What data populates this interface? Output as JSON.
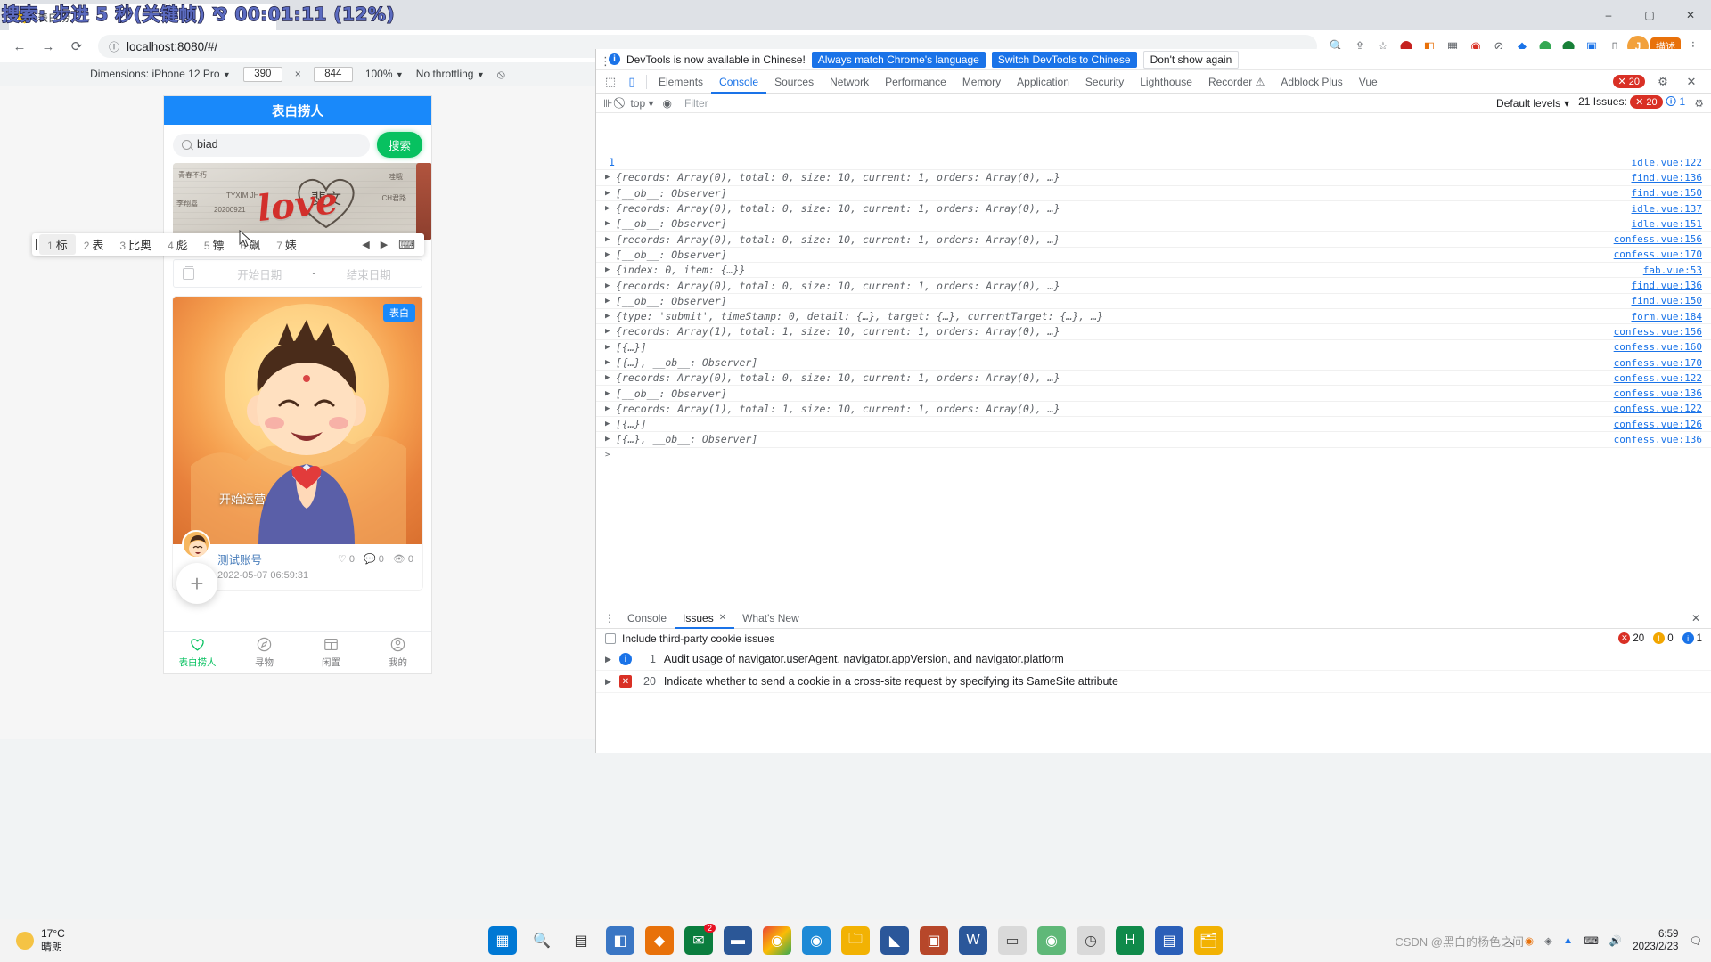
{
  "recorder_overlay": "搜索: 步进 5 秒(关键帧) ⅋ 00:01:11 (12%)",
  "browser": {
    "tab_title": "表白捞人",
    "url": "localhost:8080/#/",
    "window_buttons": [
      "–",
      "▢",
      "✕"
    ],
    "nav": {
      "back": "←",
      "forward": "→",
      "reload": "⟳"
    },
    "profile_initial": "J",
    "extension_badge": "描述",
    "toolbar_icons": [
      "zoom-icon",
      "share-icon",
      "bookmark-star-icon",
      "ext-1",
      "ext-2",
      "ext-3",
      "ext-4",
      "ext-5",
      "ext-6",
      "ext-7",
      "ext-8",
      "ext-9",
      "ext-10",
      "sidepanel-icon"
    ],
    "menu_icon": "⋮"
  },
  "device_toolbar": {
    "dimensions_label": "Dimensions: iPhone 12 Pro",
    "width": "390",
    "x": "×",
    "height": "844",
    "zoom": "100%",
    "throttling": "No throttling",
    "rotate_icon": "rotate-icon"
  },
  "app": {
    "title": "表白捞人",
    "search": {
      "value": "biad",
      "placeholder": "",
      "button": "搜索",
      "icon": "search-icon"
    },
    "ime": {
      "candidates": [
        {
          "num": "1",
          "text": "标"
        },
        {
          "num": "2",
          "text": "表"
        },
        {
          "num": "3",
          "text": "比奥"
        },
        {
          "num": "4",
          "text": "彪"
        },
        {
          "num": "5",
          "text": "镖"
        },
        {
          "num": "6",
          "text": "飙"
        },
        {
          "num": "7",
          "text": "婊"
        }
      ],
      "prev": "◀",
      "next": "▶",
      "panel": "keyboard-icon"
    },
    "carousel": {
      "dots": 2,
      "active": 0,
      "banner_text": "love"
    },
    "date_filter": {
      "start": "开始日期",
      "dash": "-",
      "end": "结束日期",
      "icon": "calendar-icon"
    },
    "post": {
      "tag": "表白",
      "caption": "开始运营",
      "author": "测试账号",
      "time": "2022-05-07 06:59:31",
      "stats": [
        "0",
        "0",
        "0"
      ]
    },
    "fab": "+",
    "tabbar": [
      {
        "label": "表白捞人",
        "icon": "heart-icon",
        "active": true
      },
      {
        "label": "寻物",
        "icon": "compass-icon",
        "active": false
      },
      {
        "label": "闲置",
        "icon": "box-icon",
        "active": false
      },
      {
        "label": "我的",
        "icon": "user-icon",
        "active": false
      }
    ]
  },
  "devtools": {
    "banner": {
      "message": "DevTools is now available in Chinese!",
      "btn_match": "Always match Chrome's language",
      "btn_switch": "Switch DevTools to Chinese",
      "btn_dismiss": "Don't show again"
    },
    "tabs": [
      "Elements",
      "Console",
      "Sources",
      "Network",
      "Performance",
      "Memory",
      "Application",
      "Security",
      "Lighthouse",
      "Recorder ⚠",
      "Adblock Plus",
      "Vue"
    ],
    "active_tab": "Console",
    "error_count": "20",
    "settings_icon": "gear-icon",
    "close_icon": "✕",
    "filterbar": {
      "context": "top",
      "filter_placeholder": "Filter",
      "levels": "Default levels",
      "issues_text": "21 Issues:",
      "issue_errors": "20",
      "issue_info": "1"
    },
    "console_rows": [
      {
        "type": "index",
        "text": "1",
        "source": "idle.vue:122"
      },
      {
        "type": "obj",
        "text": "{records: Array(0), total: 0, size: 10, current: 1, orders: Array(0), …}",
        "source": "find.vue:136"
      },
      {
        "type": "obj",
        "text": "[__ob__: Observer]",
        "source": "find.vue:150"
      },
      {
        "type": "obj",
        "text": "{records: Array(0), total: 0, size: 10, current: 1, orders: Array(0), …}",
        "source": "idle.vue:137"
      },
      {
        "type": "obj",
        "text": "[__ob__: Observer]",
        "source": "idle.vue:151"
      },
      {
        "type": "obj",
        "text": "{records: Array(0), total: 0, size: 10, current: 1, orders: Array(0), …}",
        "source": "confess.vue:156"
      },
      {
        "type": "obj",
        "text": "[__ob__: Observer]",
        "source": "confess.vue:170"
      },
      {
        "type": "obj",
        "text": "{index: 0, item: {…}}",
        "source": "fab.vue:53"
      },
      {
        "type": "obj",
        "text": "{records: Array(0), total: 0, size: 10, current: 1, orders: Array(0), …}",
        "source": "find.vue:136"
      },
      {
        "type": "obj",
        "text": "[__ob__: Observer]",
        "source": "find.vue:150"
      },
      {
        "type": "obj",
        "text": "{type: 'submit', timeStamp: 0, detail: {…}, target: {…}, currentTarget: {…}, …}",
        "source": "form.vue:184"
      },
      {
        "type": "obj",
        "text": "{records: Array(1), total: 1, size: 10, current: 1, orders: Array(0), …}",
        "source": "confess.vue:156"
      },
      {
        "type": "obj",
        "text": "[{…}]",
        "source": "confess.vue:160"
      },
      {
        "type": "obj",
        "text": "[{…}, __ob__: Observer]",
        "source": "confess.vue:170"
      },
      {
        "type": "obj",
        "text": "{records: Array(0), total: 0, size: 10, current: 1, orders: Array(0), …}",
        "source": "confess.vue:122"
      },
      {
        "type": "obj",
        "text": "[__ob__: Observer]",
        "source": "confess.vue:136"
      },
      {
        "type": "obj",
        "text": "{records: Array(1), total: 1, size: 10, current: 1, orders: Array(0), …}",
        "source": "confess.vue:122"
      },
      {
        "type": "obj",
        "text": "[{…}]",
        "source": "confess.vue:126"
      },
      {
        "type": "obj",
        "text": "[{…}, __ob__: Observer]",
        "source": "confess.vue:136"
      },
      {
        "type": "prompt",
        "text": ">",
        "source": ""
      }
    ],
    "drawer": {
      "tabs": [
        "Console",
        "Issues",
        "What's New"
      ],
      "active": "Issues",
      "close": "✕",
      "third_party_label": "Include third-party cookie issues",
      "counts": {
        "errors": "20",
        "warnings": "0",
        "info": "1"
      },
      "issues": [
        {
          "severity": "info",
          "count": "1",
          "text": "Audit usage of navigator.userAgent, navigator.appVersion, and navigator.platform"
        },
        {
          "severity": "error",
          "count": "20",
          "text": "Indicate whether to send a cookie in a cross-site request by specifying its SameSite attribute"
        }
      ]
    }
  },
  "taskbar": {
    "weather": {
      "temp": "17°C",
      "desc": "晴朗"
    },
    "apps": [
      "start-icon",
      "search-icon",
      "taskview-icon",
      "widgets-icon",
      "store-icon",
      "mail-icon",
      "teams-icon",
      "chrome-icon",
      "edge-icon",
      "folder-icon",
      "vscode-icon",
      "word-icon",
      "terminal-icon",
      "chrome2-icon",
      "clock-icon",
      "hyper-icon",
      "wps-icon",
      "explorer-icon"
    ],
    "mail_badge": "2",
    "time": "6:59",
    "date": "2023/2/23",
    "watermark": "CSDN @黑白的杨色之间"
  },
  "colors": {
    "brand_blue": "#1989fa",
    "green": "#07c160",
    "devtools_blue": "#1a73e8",
    "error_red": "#d93025"
  }
}
